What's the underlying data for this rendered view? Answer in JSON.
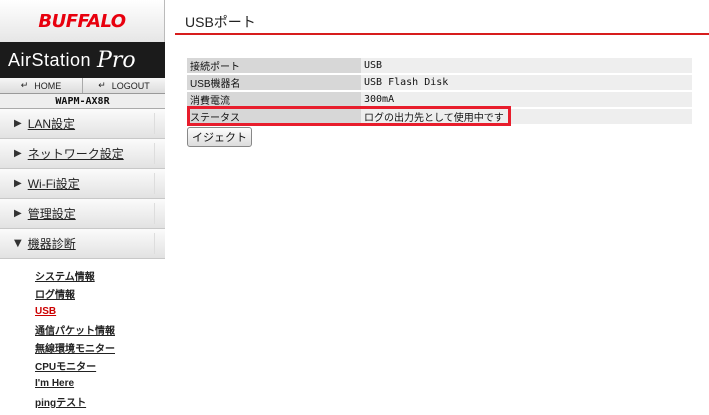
{
  "brand": {
    "logo": "BUFFALO",
    "product_a": "AirStation",
    "product_b": "Pro",
    "model": "WAPM-AX8R"
  },
  "nav": {
    "home": "HOME",
    "logout": "LOGOUT"
  },
  "menu": [
    {
      "label": "LAN設定"
    },
    {
      "label": "ネットワーク設定"
    },
    {
      "label": "Wi-Fi設定"
    },
    {
      "label": "管理設定"
    },
    {
      "label": "機器診断"
    }
  ],
  "submenu": [
    {
      "label": "システム情報"
    },
    {
      "label": "ログ情報"
    },
    {
      "label": "USB"
    },
    {
      "label": "通信パケット情報"
    },
    {
      "label": "無線環境モニター"
    },
    {
      "label": "CPUモニター"
    },
    {
      "label": "I'm Here"
    },
    {
      "label": "pingテスト"
    }
  ],
  "page": {
    "title": "USBポート"
  },
  "table": [
    {
      "label": "接続ポート",
      "value": "USB"
    },
    {
      "label": "USB機器名",
      "value": "USB Flash Disk"
    },
    {
      "label": "消費電流",
      "value": "300mA"
    },
    {
      "label": "ステータス",
      "value": "ログの出力先として使用中です"
    }
  ],
  "eject_label": "イジェクト",
  "colors": {
    "accent": "#d71d1d",
    "highlight": "#e81d2c"
  }
}
